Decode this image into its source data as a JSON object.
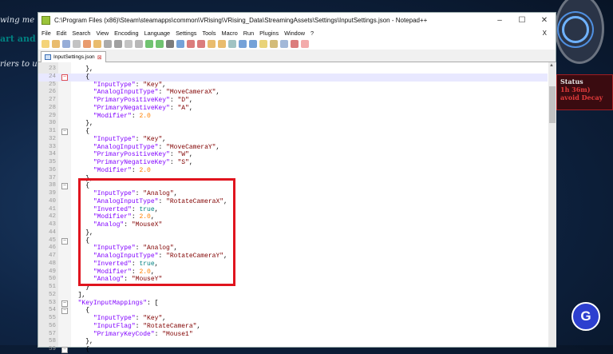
{
  "background": {
    "lines": [
      "wing me to f",
      "art and int",
      "riers to unl"
    ],
    "status": {
      "title": "Status",
      "time": "1h 36m)",
      "decay": "avoid Decay"
    },
    "logo": "G"
  },
  "window": {
    "title": "C:\\Program Files (x86)\\Steam\\steamapps\\common\\VRising\\VRising_Data\\StreamingAssets\\Settings\\InputSettings.json - Notepad++",
    "controls": {
      "minimize": "–",
      "maximize": "☐",
      "close": "✕"
    },
    "menu": [
      "File",
      "Edit",
      "Search",
      "View",
      "Encoding",
      "Language",
      "Settings",
      "Tools",
      "Macro",
      "Run",
      "Plugins",
      "Window",
      "?"
    ],
    "menu_close": "X",
    "tab": {
      "label": "InputSettings.json",
      "close": "⊠"
    }
  },
  "editor": {
    "current_line": 24,
    "lines": [
      {
        "n": 23,
        "text": "    },"
      },
      {
        "n": 24,
        "text": "    {",
        "fold": "red"
      },
      {
        "n": 25,
        "text": "      \"InputType\": \"Key\","
      },
      {
        "n": 26,
        "text": "      \"AnalogInputType\": \"MoveCameraX\","
      },
      {
        "n": 27,
        "text": "      \"PrimaryPositiveKey\": \"D\","
      },
      {
        "n": 28,
        "text": "      \"PrimaryNegativeKey\": \"A\","
      },
      {
        "n": 29,
        "text": "      \"Modifier\": 2.0"
      },
      {
        "n": 30,
        "text": "    },"
      },
      {
        "n": 31,
        "text": "    {",
        "fold": "box"
      },
      {
        "n": 32,
        "text": "      \"InputType\": \"Key\","
      },
      {
        "n": 33,
        "text": "      \"AnalogInputType\": \"MoveCameraY\","
      },
      {
        "n": 34,
        "text": "      \"PrimaryPositiveKey\": \"W\","
      },
      {
        "n": 35,
        "text": "      \"PrimaryNegativeKey\": \"S\","
      },
      {
        "n": 36,
        "text": "      \"Modifier\": 2.0"
      },
      {
        "n": 37,
        "text": "    },"
      },
      {
        "n": 38,
        "text": "    {",
        "fold": "box"
      },
      {
        "n": 39,
        "text": "      \"InputType\": \"Analog\","
      },
      {
        "n": 40,
        "text": "      \"AnalogInputType\": \"RotateCameraX\","
      },
      {
        "n": 41,
        "text": "      \"Inverted\": true,"
      },
      {
        "n": 42,
        "text": "      \"Modifier\": 2.0,"
      },
      {
        "n": 43,
        "text": "      \"Analog\": \"MouseX\""
      },
      {
        "n": 44,
        "text": "    },"
      },
      {
        "n": 45,
        "text": "    {",
        "fold": "box"
      },
      {
        "n": 46,
        "text": "      \"InputType\": \"Analog\","
      },
      {
        "n": 47,
        "text": "      \"AnalogInputType\": \"RotateCameraY\","
      },
      {
        "n": 48,
        "text": "      \"Inverted\": true,"
      },
      {
        "n": 49,
        "text": "      \"Modifier\": 2.0,"
      },
      {
        "n": 50,
        "text": "      \"Analog\": \"MouseY\""
      },
      {
        "n": 51,
        "text": "    }"
      },
      {
        "n": 52,
        "text": "  ],"
      },
      {
        "n": 53,
        "text": "  \"KeyInputMappings\": [",
        "fold": "box"
      },
      {
        "n": 54,
        "text": "    {",
        "fold": "box"
      },
      {
        "n": 55,
        "text": "      \"InputType\": \"Key\","
      },
      {
        "n": 56,
        "text": "      \"InputFlag\": \"RotateCamera\","
      },
      {
        "n": 57,
        "text": "      \"PrimaryKeyCode\": \"Mouse1\""
      },
      {
        "n": 58,
        "text": "    },"
      },
      {
        "n": 59,
        "text": "    {",
        "fold": "box"
      }
    ]
  },
  "colors": {
    "highlight_box": "#e0141e",
    "key": "#8000ff",
    "string": "#800000",
    "number": "#ff8000",
    "bool": "#008080"
  }
}
